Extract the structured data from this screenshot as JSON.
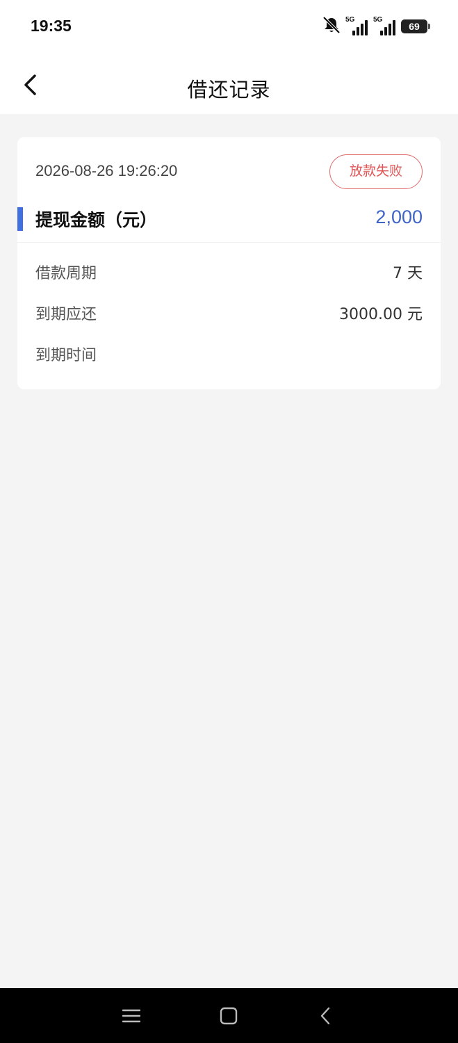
{
  "status_bar": {
    "time": "19:35",
    "sim1_label": "5G",
    "sim2_label": "5G",
    "battery": "69",
    "icons": [
      "mute-icon",
      "signal-icon",
      "signal-icon",
      "battery-icon"
    ]
  },
  "header": {
    "title": "借还记录",
    "back_icon": "chevron-left-icon"
  },
  "record": {
    "datetime": "2026-08-26 19:26:20",
    "status": "放款失败",
    "amount_label": "提现金额（元）",
    "amount_value": "2,000",
    "details": [
      {
        "label": "借款周期",
        "value": "7 天"
      },
      {
        "label": "到期应还",
        "value": "3000.00 元"
      },
      {
        "label": "到期时间",
        "value": ""
      }
    ]
  },
  "system_nav": {
    "icons": [
      "menu-icon",
      "home-icon",
      "back-icon"
    ]
  },
  "colors": {
    "accent": "#3f6fe0",
    "amount": "#3f64c8",
    "status_fail": "#e05555",
    "background": "#f4f4f4"
  }
}
